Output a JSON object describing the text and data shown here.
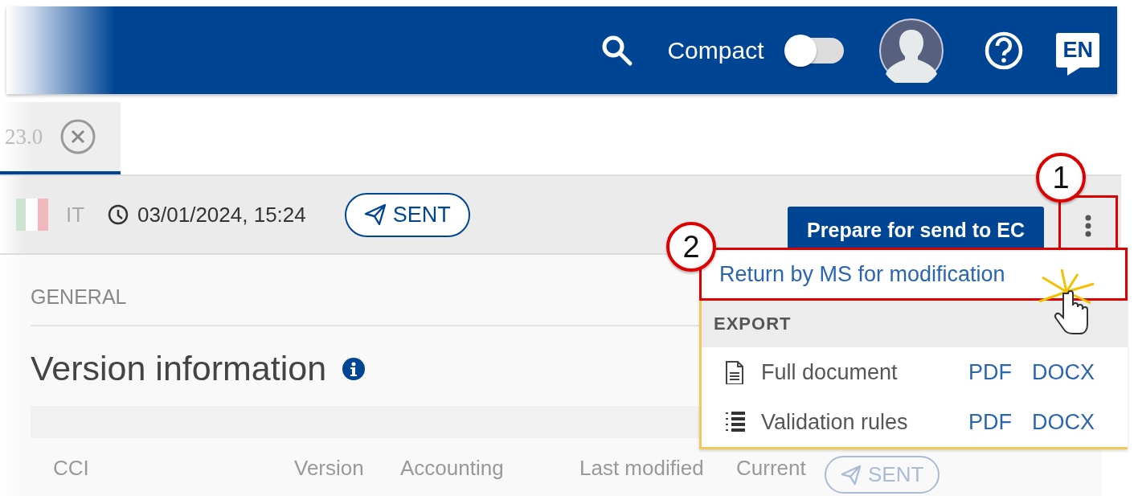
{
  "header": {
    "compact_label": "Compact",
    "compact_on": false,
    "language": "EN"
  },
  "tab": {
    "label": "23.0",
    "selected": true
  },
  "toolbar": {
    "country": "IT",
    "timestamp": "03/01/2024, 15:24",
    "status": "SENT",
    "primary_button": "Prepare for send to EC"
  },
  "section": {
    "label": "GENERAL",
    "heading": "Version information"
  },
  "table": {
    "columns": [
      "CCI",
      "Version",
      "Accounting",
      "Last modified",
      "Current"
    ],
    "status": "SENT"
  },
  "menu": {
    "items": [
      {
        "label": "Return by MS for modification"
      }
    ],
    "export_heading": "EXPORT",
    "exports": [
      {
        "kind": "document",
        "label": "Full document",
        "formats": [
          "PDF",
          "DOCX"
        ]
      },
      {
        "kind": "rules",
        "label": "Validation rules",
        "formats": [
          "PDF",
          "DOCX"
        ]
      }
    ]
  },
  "callouts": [
    {
      "label": "1"
    },
    {
      "label": "2"
    }
  ]
}
